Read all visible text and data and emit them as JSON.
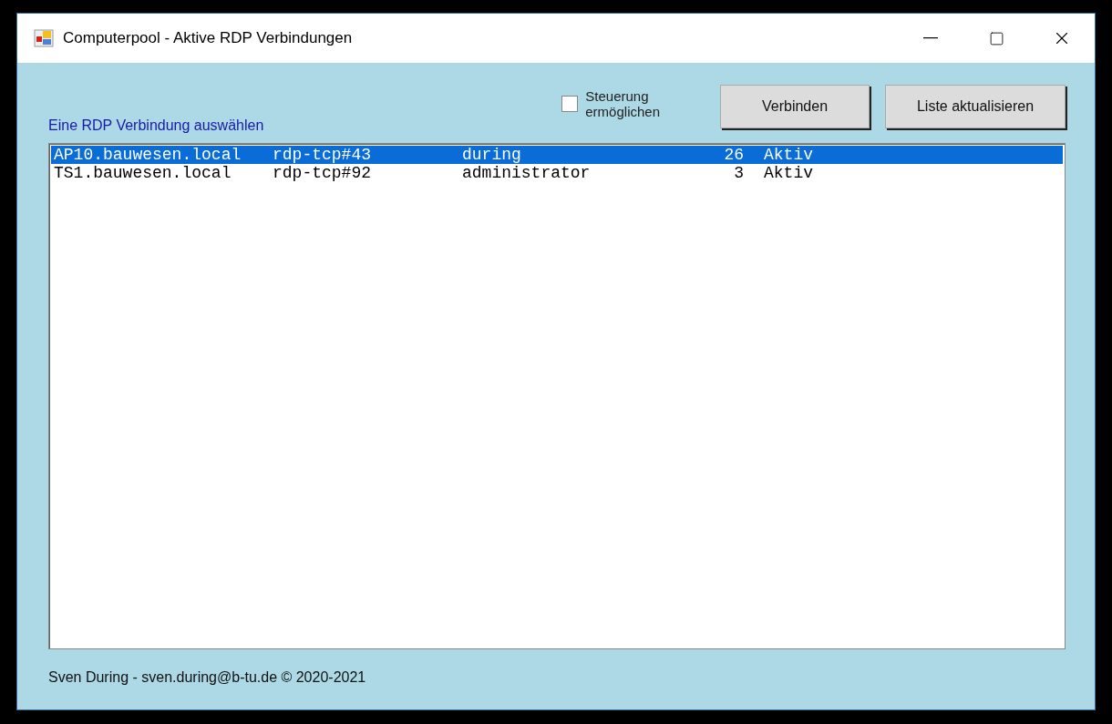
{
  "window": {
    "title": "Computerpool - Aktive RDP Verbindungen"
  },
  "list_label": "Eine RDP Verbindung auswählen",
  "control_checkbox": {
    "label_lines": [
      "Steuerung",
      "ermöglichen"
    ],
    "checked": false
  },
  "buttons": [
    "Verbinden",
    "Liste aktualisieren"
  ],
  "sessions": [
    {
      "host": "AP10.bauwesen.local",
      "session": "rdp-tcp#43",
      "user": "during",
      "id": "26",
      "state": "Aktiv",
      "selected": true
    },
    {
      "host": "TS1.bauwesen.local",
      "session": "rdp-tcp#92",
      "user": "administrator",
      "id": "3",
      "state": "Aktiv",
      "selected": false
    }
  ],
  "footer": "Sven During - sven.during@b-tu.de © 2020-2021"
}
